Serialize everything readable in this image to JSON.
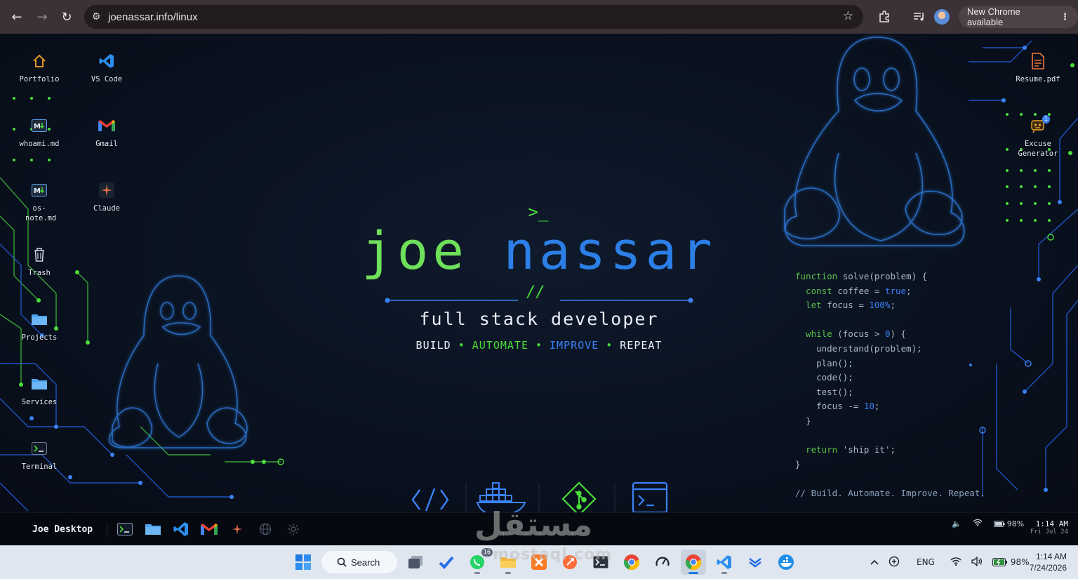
{
  "browser": {
    "url": "joenassar.info/linux",
    "update_label": "New Chrome available",
    "icons": [
      "back-icon",
      "forward-icon",
      "reload-icon",
      "site-settings-icon",
      "bookmark-star-icon",
      "extensions-icon",
      "media-controls-icon",
      "profile-avatar",
      "menu-dots-icon"
    ]
  },
  "desktop": {
    "left_icons": [
      {
        "label": "Portfolio",
        "icon": "home-icon"
      },
      {
        "label": "VS Code",
        "icon": "vscode-icon"
      },
      {
        "label": "whoami.md",
        "icon": "markdown-icon"
      },
      {
        "label": "Gmail",
        "icon": "gmail-icon"
      },
      {
        "label": "os-note.md",
        "icon": "markdown-icon"
      },
      {
        "label": "Claude",
        "icon": "claude-icon"
      },
      {
        "label": "Trash",
        "icon": "trash-icon"
      },
      {
        "label": "Projects",
        "icon": "folder-icon"
      },
      {
        "label": "Services",
        "icon": "folder-icon"
      },
      {
        "label": "Terminal",
        "icon": "terminal-icon"
      }
    ],
    "right_icons": [
      {
        "label": "Resume.pdf",
        "icon": "pdf-icon"
      },
      {
        "label": "Excuse Generator",
        "icon": "robot-icon",
        "badge": "1"
      }
    ]
  },
  "hero": {
    "prompt": ">_",
    "first_name": "joe",
    "last_name": "nassar",
    "divider": "//",
    "role": "full stack developer",
    "motto": [
      "BUILD",
      "AUTOMATE",
      "IMPROVE",
      "REPEAT"
    ],
    "separator": "•"
  },
  "code": {
    "l1a": "function",
    "l1b": " solve(problem) {",
    "l2a": "  const",
    "l2b": " coffee = ",
    "l2c": "true",
    "l2d": ";",
    "l3a": "  let",
    "l3b": " focus = ",
    "l3c": "100%",
    "l3d": ";",
    "l4a": "  while",
    "l4b": " (focus > ",
    "l4c": "0",
    "l4d": ") {",
    "l5": "    understand(problem);",
    "l6": "    plan();",
    "l7": "    code();",
    "l8": "    test();",
    "l9a": "    focus -= ",
    "l9b": "10",
    "l9c": ";",
    "l10": "  }",
    "l11a": "  return",
    "l11b": " 'ship it';",
    "l12": "}",
    "comment": "// Build. Automate. Improve. Repeat."
  },
  "tech_icons": [
    "code-brackets-icon",
    "docker-icon",
    "git-icon",
    "terminal-window-icon"
  ],
  "linux_taskbar": {
    "title": "Joe Desktop",
    "apps": [
      "terminal-icon",
      "folder-icon",
      "vscode-icon",
      "gmail-icon",
      "claude-icon",
      "globe-icon",
      "settings-icon"
    ],
    "battery": "98%",
    "time": "1:14 AM",
    "date": "Fri Jul 24"
  },
  "windows_taskbar": {
    "search_label": "Search",
    "whatsapp_badge": "16",
    "lang": "ENG",
    "battery": "98%",
    "time": "1:14 AM",
    "date": "7/24/2026"
  },
  "watermark": {
    "arabic": "مستقل",
    "latin": "mostaql.com"
  },
  "colors": {
    "accent_green": "#4ade3a",
    "accent_blue": "#2d7fe8",
    "background": "#0a1220"
  }
}
